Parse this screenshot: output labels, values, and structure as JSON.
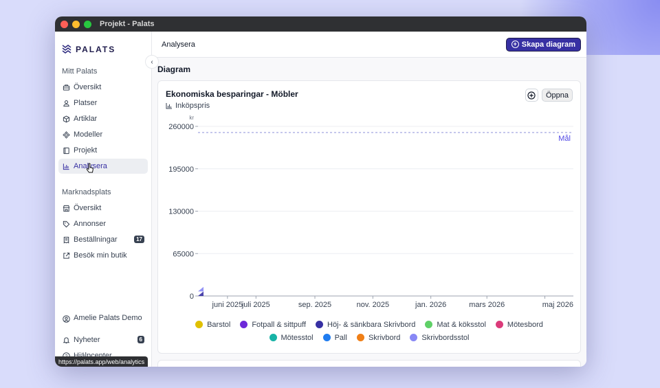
{
  "window": {
    "title": "Projekt - Palats"
  },
  "sidebar": {
    "logo_text": "PALATS",
    "section1_title": "Mitt Palats",
    "items1": [
      {
        "label": "Översikt",
        "icon": "briefcase-icon"
      },
      {
        "label": "Platser",
        "icon": "person-pin-icon"
      },
      {
        "label": "Artiklar",
        "icon": "box-icon"
      },
      {
        "label": "Modeller",
        "icon": "components-icon"
      },
      {
        "label": "Projekt",
        "icon": "book-icon"
      },
      {
        "label": "Analysera",
        "icon": "bar-chart-icon",
        "active": true
      }
    ],
    "section2_title": "Marknadsplats",
    "items2": [
      {
        "label": "Översikt",
        "icon": "store-icon"
      },
      {
        "label": "Annonser",
        "icon": "tag-icon"
      },
      {
        "label": "Beställningar",
        "icon": "receipt-icon",
        "badge": "17"
      },
      {
        "label": "Besök min butik",
        "icon": "external-link-icon"
      }
    ],
    "user": {
      "name": "Amelie Palats Demo"
    },
    "news": {
      "label": "Nyheter",
      "badge": "6"
    },
    "help": {
      "label": "Hjälpcenter"
    },
    "status_url": "https://palats.app/web/analytics"
  },
  "header": {
    "title": "Analysera",
    "create_button": "Skapa diagram"
  },
  "page": {
    "title": "Diagram"
  },
  "card": {
    "title": "Ekonomiska besparingar - Möbler",
    "subtitle": "Inköpspris",
    "open_button": "Öppna"
  },
  "chart_data": {
    "type": "area",
    "title": "Ekonomiska besparingar - Möbler",
    "subtitle": "Inköpspris",
    "ylabel": "kr",
    "ylim": [
      0,
      260000
    ],
    "y_ticks": [
      "260000",
      "195000",
      "130000",
      "65000",
      "0"
    ],
    "y_tick_values": [
      260000,
      195000,
      130000,
      65000,
      0
    ],
    "x_ticks": [
      "juni 2025",
      "juli 2025",
      "sep. 2025",
      "nov. 2025",
      "jan. 2026",
      "mars 2026",
      "maj 2026"
    ],
    "x_range": [
      "2025-05-01",
      "2026-05-31"
    ],
    "x_tick_dates": [
      "2025-06-01",
      "2025-07-01",
      "2025-09-01",
      "2025-11-01",
      "2026-01-01",
      "2026-03-01",
      "2026-05-01"
    ],
    "goal": {
      "label": "Mål",
      "value": 260000
    },
    "grid": true,
    "legend_position": "bottom",
    "series": [
      {
        "name": "Barstol",
        "color": "#e0c000",
        "values": [
          0
        ]
      },
      {
        "name": "Fotpall & sittpuff",
        "color": "#6d28d9",
        "values": [
          0
        ]
      },
      {
        "name": "Höj- & sänkbara Skrivbord",
        "color": "#3730a3",
        "values": [
          7000
        ]
      },
      {
        "name": "Mat & köksstol",
        "color": "#5fd067",
        "values": [
          0
        ]
      },
      {
        "name": "Mötesbord",
        "color": "#db3b7a",
        "values": [
          0
        ]
      },
      {
        "name": "Mötesstol",
        "color": "#17b3a6",
        "values": [
          0
        ]
      },
      {
        "name": "Pall",
        "color": "#1f7cf0",
        "values": [
          0
        ]
      },
      {
        "name": "Skrivbord",
        "color": "#f07f16",
        "values": [
          0
        ]
      },
      {
        "name": "Skrivbordsstol",
        "color": "#8888f5",
        "values": [
          7000
        ]
      }
    ],
    "series_dates": [
      "2025-05-01"
    ]
  }
}
